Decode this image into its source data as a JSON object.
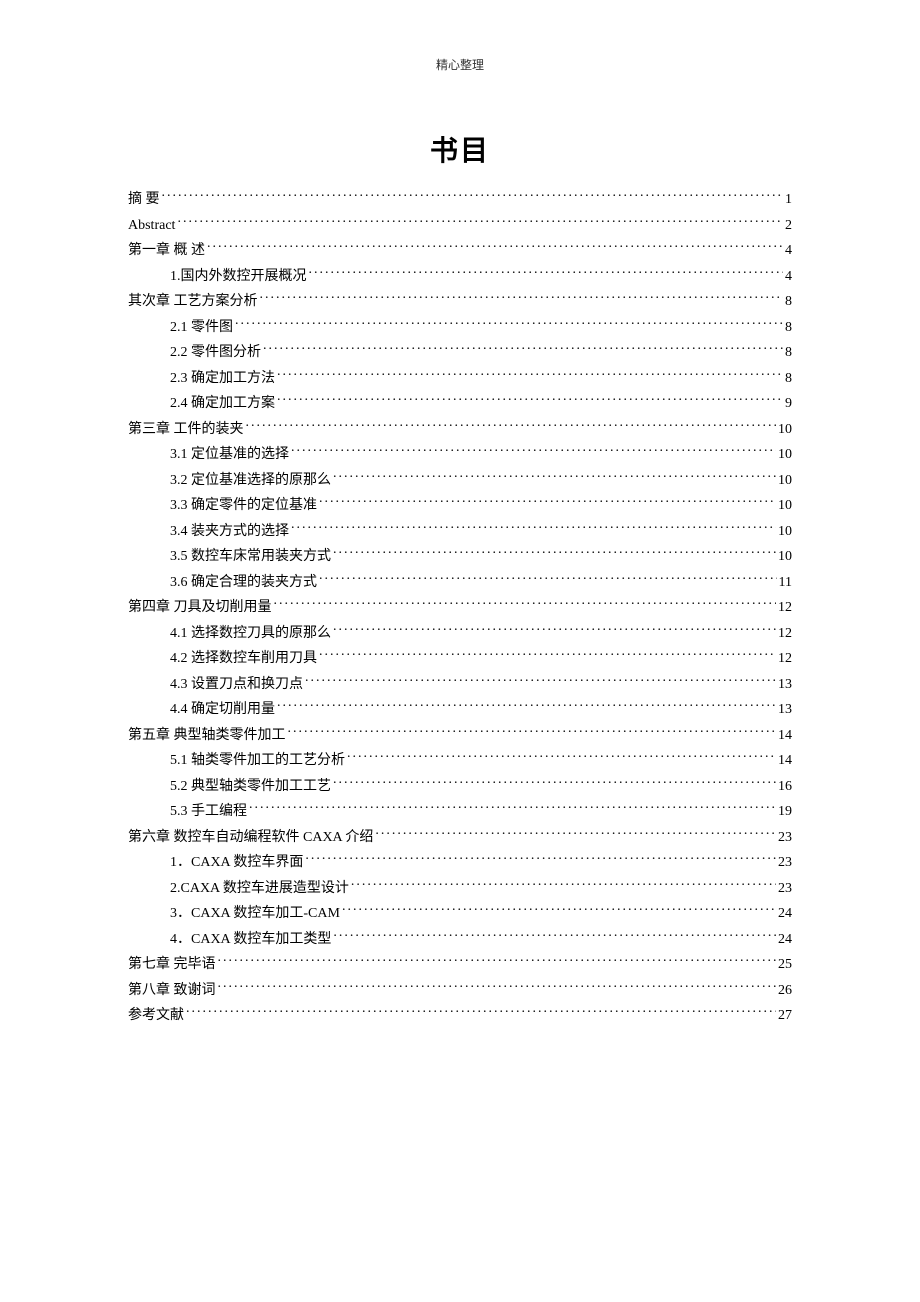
{
  "header": "精心整理",
  "title": "书目",
  "toc": [
    {
      "level": 1,
      "label": "摘    要",
      "page": "1"
    },
    {
      "level": 1,
      "label": "Abstract",
      "page": "2"
    },
    {
      "level": 1,
      "label": "第一章    概    述",
      "page": "4"
    },
    {
      "level": 2,
      "label": "1.国内外数控开展概况",
      "page": "4"
    },
    {
      "level": 1,
      "label": "其次章    工艺方案分析",
      "page": "8"
    },
    {
      "level": 2,
      "label": "2.1  零件图",
      "page": "8"
    },
    {
      "level": 2,
      "label": "2.2 零件图分析",
      "page": "8"
    },
    {
      "level": 2,
      "label": "2.3 确定加工方法",
      "page": "8"
    },
    {
      "level": 2,
      "label": "2.4 确定加工方案",
      "page": "9"
    },
    {
      "level": 1,
      "label": "第三章    工件的装夹",
      "page": "10"
    },
    {
      "level": 2,
      "label": "3.1 定位基准的选择",
      "page": "10"
    },
    {
      "level": 2,
      "label": "3.2 定位基准选择的原那么",
      "page": "10"
    },
    {
      "level": 2,
      "label": "3.3 确定零件的定位基准",
      "page": "10"
    },
    {
      "level": 2,
      "label": "3.4 装夹方式的选择",
      "page": "10"
    },
    {
      "level": 2,
      "label": "3.5 数控车床常用装夹方式",
      "page": "10"
    },
    {
      "level": 2,
      "label": "3.6 确定合理的装夹方式",
      "page": "11"
    },
    {
      "level": 1,
      "label": "第四章    刀具及切削用量",
      "page": "12"
    },
    {
      "level": 2,
      "label": "4.1 选择数控刀具的原那么",
      "page": "12"
    },
    {
      "level": 2,
      "label": "4.2 选择数控车削用刀具",
      "page": "12"
    },
    {
      "level": 2,
      "label": "4.3 设置刀点和换刀点",
      "page": "13"
    },
    {
      "level": 2,
      "label": "4.4 确定切削用量",
      "page": "13"
    },
    {
      "level": 1,
      "label": "第五章  典型轴类零件加工",
      "page": "14"
    },
    {
      "level": 2,
      "label": "5.1  轴类零件加工的工艺分析",
      "page": "14"
    },
    {
      "level": 2,
      "label": "5.2  典型轴类零件加工工艺",
      "page": "16"
    },
    {
      "level": 2,
      "label": "5.3  手工编程",
      "page": "19"
    },
    {
      "level": 1,
      "label": "第六章    数控车自动编程软件 CAXA 介绍",
      "page": "23"
    },
    {
      "level": 2,
      "label": "1．CAXA 数控车界面",
      "page": "23"
    },
    {
      "level": 2,
      "label": "2.CAXA 数控车进展造型设计",
      "page": "23"
    },
    {
      "level": 2,
      "label": "3．CAXA 数控车加工-CAM",
      "page": "24"
    },
    {
      "level": 2,
      "label": "4．CAXA 数控车加工类型",
      "page": "24"
    },
    {
      "level": 1,
      "label": "第七章    完毕语",
      "page": "25"
    },
    {
      "level": 1,
      "label": "第八章    致谢词",
      "page": "26"
    },
    {
      "level": 1,
      "label": "参考文献",
      "page": "27"
    }
  ]
}
